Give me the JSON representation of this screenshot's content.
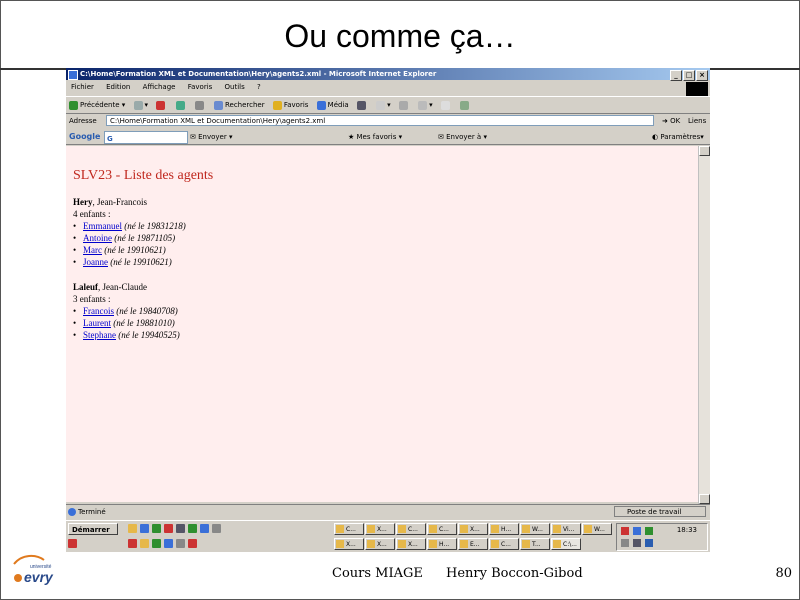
{
  "slide": {
    "title": "Ou comme ça…",
    "footer_course": "Cours MIAGE",
    "footer_author": "Henry Boccon-Gibod",
    "page_number": "80",
    "logo_text": "université evry"
  },
  "browser": {
    "window_title": "C:\\Home\\Formation XML et Documentation\\Hery\\agents2.xml - Microsoft Internet Explorer",
    "menu": [
      "Fichier",
      "Edition",
      "Affichage",
      "Favoris",
      "Outils",
      "?"
    ],
    "toolbar": {
      "back": "Précédente",
      "search": "Rechercher",
      "favorites": "Favoris",
      "media": "Média"
    },
    "address_label": "Adresse",
    "address_value": "C:\\Home\\Formation XML et Documentation\\Hery\\agents2.xml",
    "go_label": "OK",
    "links_label": "Liens",
    "google": {
      "logo": "Google",
      "search_placeholder": "G",
      "send": "Envoyer",
      "my_favorites": "Mes favoris",
      "send_to": "Envoyer à",
      "settings": "Paramètres"
    },
    "status_text": "Terminé",
    "status_zone": "Poste de travail"
  },
  "document": {
    "heading": "SLV23 - Liste des agents",
    "agents": [
      {
        "surname": "Hery",
        "firstname": ", Jean-Francois",
        "children_count": "4 enfants :",
        "children": [
          {
            "name": "Emmanuel",
            "born": "(né le 19831218)"
          },
          {
            "name": "Antoine",
            "born": "(né le 19871105)"
          },
          {
            "name": "Marc",
            "born": "(né le 19910621)"
          },
          {
            "name": "Joanne",
            "born": "(né le 19910621)"
          }
        ]
      },
      {
        "surname": "Laleuf",
        "firstname": ", Jean-Claude",
        "children_count": "3 enfants :",
        "children": [
          {
            "name": "Francois",
            "born": "(né le 19840708)"
          },
          {
            "name": "Laurent",
            "born": "(né le 19881010)"
          },
          {
            "name": "Stephane",
            "born": "(né le 19940525)"
          }
        ]
      }
    ]
  },
  "taskbar": {
    "start": "Démarrer",
    "clock": "18:33",
    "tasks_row1": [
      "C...",
      "X...",
      "C...",
      "C...",
      "X...",
      "H...",
      "W...",
      "Vi...",
      "W..."
    ],
    "tasks_row2": [
      "X...",
      "X...",
      "X...",
      "H...",
      "E...",
      "C...",
      "T...",
      "C:\\..."
    ]
  },
  "colors": {
    "heading": "#c0281e",
    "content_bg": "#ffeeee",
    "titlebar_start": "#0a246a",
    "link": "#0000cc"
  }
}
